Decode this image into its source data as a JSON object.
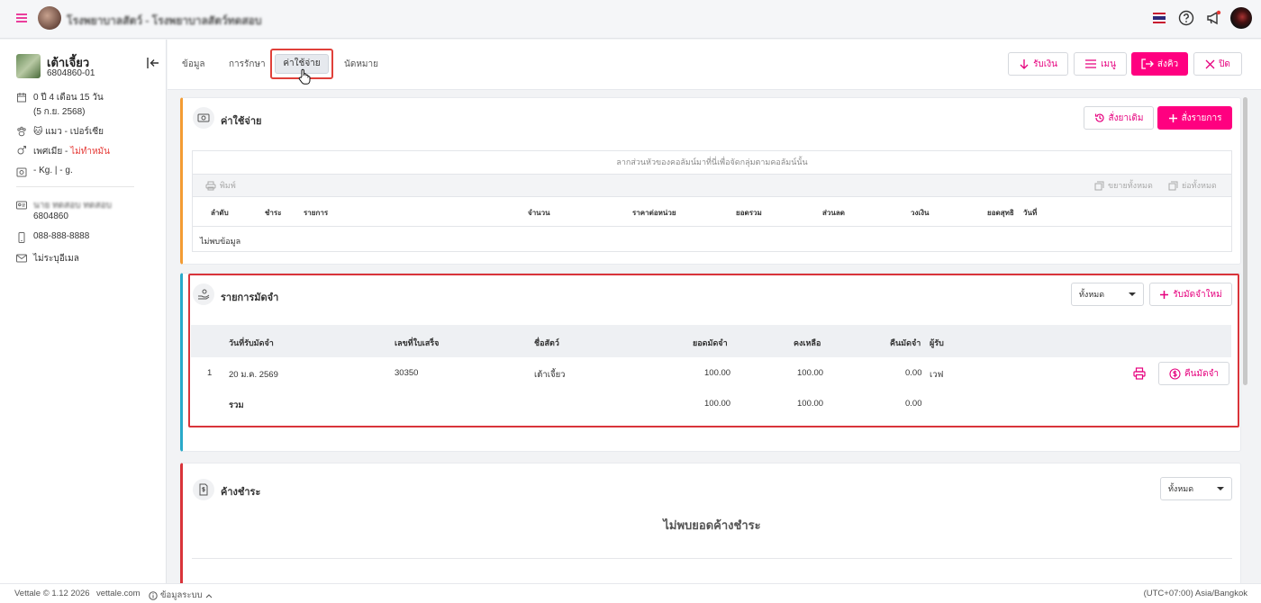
{
  "topbar": {
    "clinic_name": "โรงพยาบาลสัตว์ - โรงพยาบาลสัตว์ทดสอบ",
    "menu_icon": "hamburger-icon",
    "help_icon": "help-circle-icon",
    "announce_icon": "megaphone-icon",
    "flag": "thai-flag-icon",
    "accent_color": "#ff0080"
  },
  "pet": {
    "name": "เต้าเจี้ยว",
    "id": "6804860-01",
    "age": "0 ปี 4 เดือน 15 วัน",
    "birth": "(5 ก.ย. 2568)",
    "emoji": "🐱",
    "species": "แมว - เปอร์เซีย",
    "sex_label": "เพศเมีย - ",
    "sex_status": "ไม่ทำหมัน",
    "weight": "- Kg. | - g."
  },
  "owner": {
    "name": "นาย ทดสอบ ทดสอบ",
    "id": "6804860",
    "phone": "088-888-8888",
    "email": "ไม่ระบุอีเมล"
  },
  "tabs": {
    "info": "ข้อมูล",
    "treatment": "การรักษา",
    "expenses": "ค่าใช้จ่าย",
    "appointment": "นัดหมาย"
  },
  "actions": {
    "receive": "รับเงิน",
    "menu": "เมนู",
    "send_queue": "ส่งคิว",
    "close": "ปิด"
  },
  "expenses": {
    "title": "ค่าใช้จ่าย",
    "reorder": "สั่งยาเดิม",
    "add_items": "สั่งรายการ",
    "group_hint": "ลากส่วนหัวของคอลัมน์มาที่นี่เพื่อจัดกลุ่มตามคอลัมน์นั้น",
    "print": "พิมพ์",
    "expand_all": "ขยายทั้งหมด",
    "collapse_all": "ย่อทั้งหมด",
    "columns": [
      "ลำดับ",
      "ชำระ",
      "รายการ",
      "จำนวน",
      "ราคาต่อหน่วย",
      "ยอดรวม",
      "ส่วนลด",
      "วงเงิน",
      "ยอดสุทธิ",
      "วันที่"
    ],
    "empty": "ไม่พบข้อมูล"
  },
  "deposits": {
    "title": "รายการมัดจำ",
    "filter": "ทั้งหมด",
    "new": "รับมัดจำใหม่",
    "columns": [
      "วันที่รับมัดจำ",
      "เลขที่ใบเสร็จ",
      "ชื่อสัตว์",
      "ยอดมัดจำ",
      "คงเหลือ",
      "คืนมัดจำ",
      "ผู้รับ"
    ],
    "rows": [
      {
        "no": "1",
        "date": "20 ม.ค. 2569",
        "receipt": "30350",
        "pet": "เต้าเจี้ยว",
        "amount": "100.00",
        "balance": "100.00",
        "refunded": "0.00",
        "receiver": "เวฟ"
      }
    ],
    "refund_button": "คืนมัดจำ",
    "total_label": "รวม",
    "total_amount": "100.00",
    "total_balance": "100.00",
    "total_refunded": "0.00"
  },
  "outstanding": {
    "title": "ค้างชำระ",
    "filter": "ทั้งหมด",
    "empty": "ไม่พบยอดค้างชำระ"
  },
  "footer": {
    "copyright": "Vettale © 1.12 2026",
    "site": "vettale.com",
    "system_info": "ข้อมูลระบบ",
    "timezone": "(UTC+07:00) Asia/Bangkok"
  }
}
